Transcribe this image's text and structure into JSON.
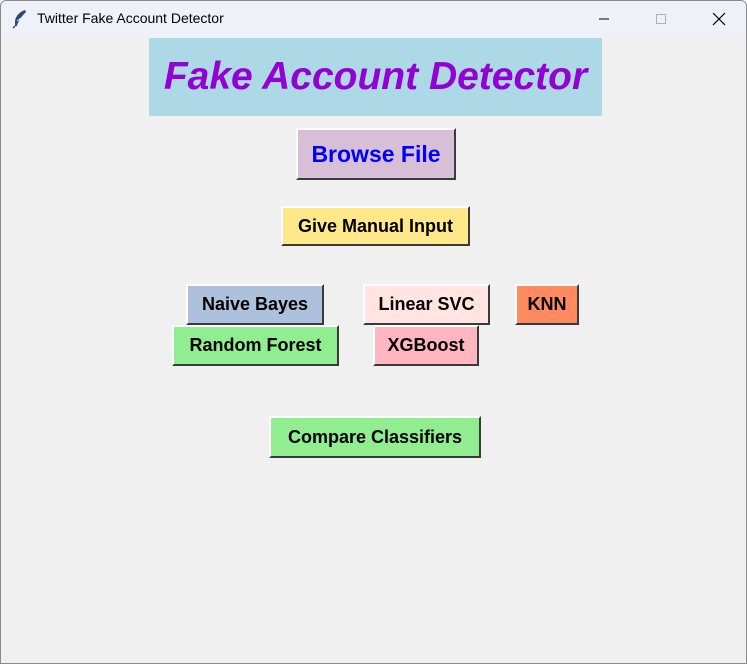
{
  "window": {
    "title": "Twitter Fake Account Detector",
    "icon": "feather-icon",
    "controls": [
      "minimize-icon",
      "maximize-icon",
      "close-icon"
    ]
  },
  "main": {
    "heading": "Fake Account Detector",
    "browse_label": "Browse File",
    "manual_label": "Give Manual Input",
    "classifiers": {
      "naive_bayes": "Naive Bayes",
      "linear_svc": "Linear SVC",
      "knn": "KNN",
      "random_forest": "Random Forest",
      "xgboost": "XGBoost"
    },
    "compare_label": "Compare Classifiers"
  },
  "colors": {
    "heading_bg": "#add8e6",
    "heading_text": "#9400d3",
    "browse_bg": "#d8bfd8",
    "browse_text": "#0000ff",
    "manual_bg": "#ffe88a",
    "naive_bg": "#aec1dc",
    "svc_bg": "#ffe4e1",
    "knn_bg": "#ff8a5f",
    "rf_bg": "#90ee90",
    "xgb_bg": "#ffb6c1",
    "compare_bg": "#90ee90"
  }
}
